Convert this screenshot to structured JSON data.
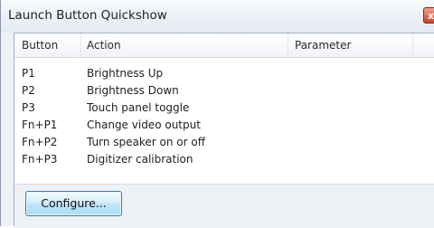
{
  "window": {
    "title": "Launch Button Quickshow",
    "close_glyph": "x"
  },
  "list": {
    "columns": [
      "Button",
      "Action",
      "Parameter"
    ],
    "rows": [
      {
        "button": "P1",
        "action": "Brightness Up",
        "parameter": ""
      },
      {
        "button": "P2",
        "action": "Brightness Down",
        "parameter": ""
      },
      {
        "button": "P3",
        "action": "Touch panel toggle",
        "parameter": ""
      },
      {
        "button": "Fn+P1",
        "action": "Change video output",
        "parameter": ""
      },
      {
        "button": "Fn+P2",
        "action": "Turn speaker on or off",
        "parameter": ""
      },
      {
        "button": "Fn+P3",
        "action": "Digitizer calibration",
        "parameter": ""
      }
    ]
  },
  "footer": {
    "configure_label": "Configure..."
  },
  "icons": {
    "close": "close-icon"
  },
  "colors": {
    "close_button": "#c7462e",
    "button_border": "#3c7fb1"
  }
}
